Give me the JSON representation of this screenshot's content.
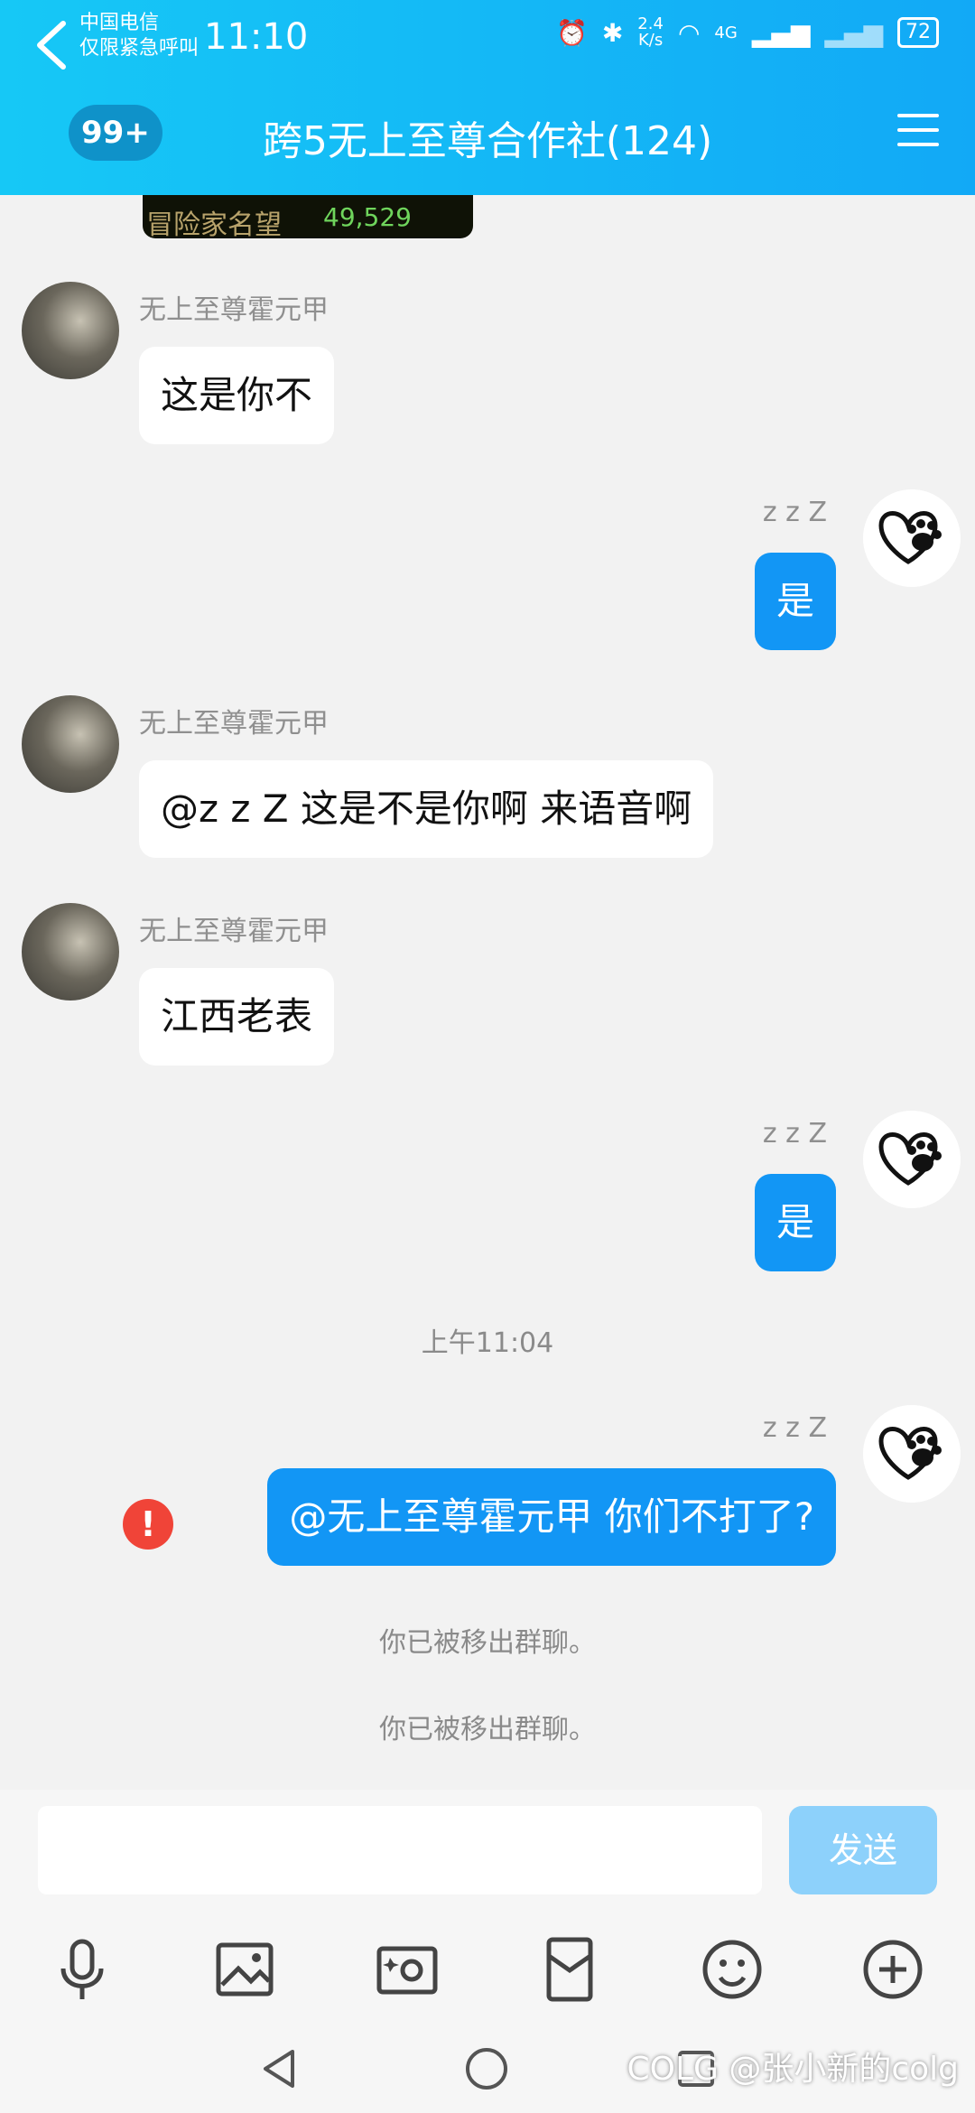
{
  "status": {
    "carrier_line1": "中国电信",
    "carrier_line2": "仅限紧急呼叫",
    "time": "11:10",
    "speed_top": "2.4",
    "speed_bottom": "K/s",
    "network": "4G",
    "battery": "72"
  },
  "header": {
    "unread_badge": "99+",
    "title": "跨5无上至尊合作社(124)",
    "colors": {
      "start": "#16c8f6",
      "end": "#12a9f6"
    }
  },
  "chat": {
    "image_strip_text": "冒险家名望",
    "image_strip_number": "49,529",
    "messages": [
      {
        "sender": "无上至尊霍元甲",
        "text": "这是你不"
      },
      {
        "sender": "z z Z",
        "text": "是"
      },
      {
        "sender": "无上至尊霍元甲",
        "text": "@z z Z 这是不是你啊 来语音啊"
      },
      {
        "sender": "无上至尊霍元甲",
        "text": "江西老表"
      },
      {
        "sender": "z z Z",
        "text": "是"
      },
      {
        "sender": "z z Z",
        "text": "@无上至尊霍元甲 你们不打了?"
      }
    ],
    "timestamp": "上午11:04",
    "error_mark": "!",
    "system_messages": [
      "你已被移出群聊。",
      "你已被移出群聊。"
    ]
  },
  "input": {
    "send_label": "发送"
  },
  "toolbar_icons": [
    "microphone-icon",
    "image-icon",
    "camera-icon",
    "red-packet-icon",
    "emoji-icon",
    "plus-icon"
  ],
  "watermark": "COLG @张小新的colg"
}
